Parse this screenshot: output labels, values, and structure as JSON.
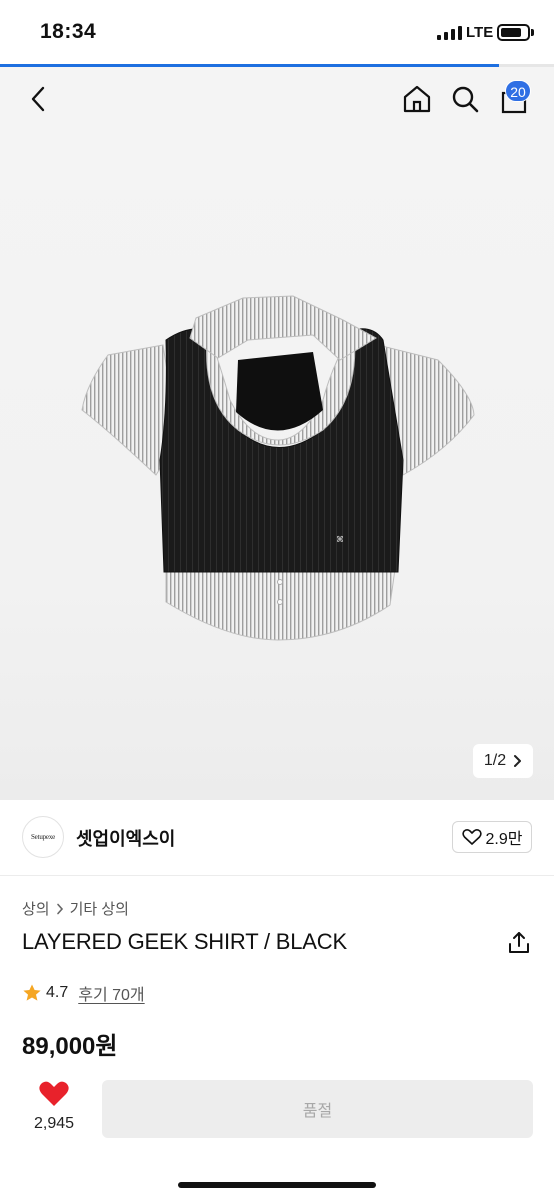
{
  "status_bar": {
    "time": "18:34",
    "network": "LTE",
    "battery_level": 0.8
  },
  "page_progress": 0.9,
  "header": {
    "back_icon": "chevron-left-icon",
    "home_icon": "home-icon",
    "search_icon": "search-icon",
    "cart_icon": "cart-icon",
    "cart_badge": "20"
  },
  "gallery": {
    "pager": "1/2",
    "image_subject": "shirt with black vest"
  },
  "brand": {
    "logo_text": "Setupexe",
    "name": "셋업이엑스이",
    "likes": "2.9만"
  },
  "breadcrumb": {
    "level1": "상의",
    "level2": "기타 상의"
  },
  "product": {
    "title": "LAYERED GEEK SHIRT / BLACK",
    "rating": "4.7",
    "reviews": "후기 70개",
    "price": "89,000원"
  },
  "actions": {
    "like_count": "2,945",
    "buy_label": "품절"
  },
  "colors": {
    "accent": "#2f6fe4",
    "progress": "#1d6fe0",
    "like_red": "#e8222b",
    "star": "#f5a623"
  }
}
